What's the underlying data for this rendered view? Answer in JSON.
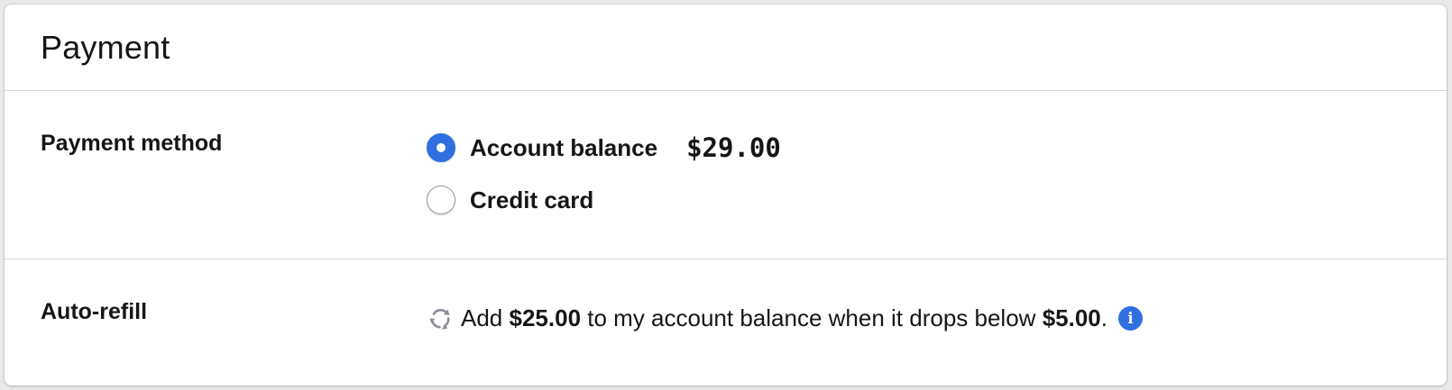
{
  "header": {
    "title": "Payment"
  },
  "payment_method": {
    "label": "Payment method",
    "options": [
      {
        "label": "Account balance",
        "selected": true,
        "amount": "$29.00"
      },
      {
        "label": "Credit card",
        "selected": false
      }
    ]
  },
  "auto_refill": {
    "label": "Auto-refill",
    "icon": "refresh-icon",
    "text_add": "Add",
    "amount": "$25.00",
    "text_middle": "to my account balance when it drops below",
    "threshold": "$5.00",
    "text_end": ".",
    "info_icon": "i"
  },
  "colors": {
    "accent": "#2f6fe0",
    "border": "#d6d6d8",
    "text": "#161616"
  }
}
